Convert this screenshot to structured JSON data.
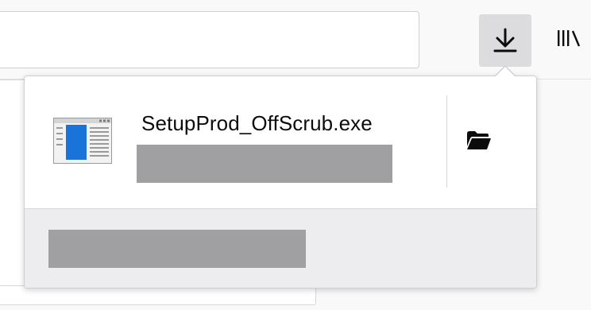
{
  "toolbar": {
    "url_value": "",
    "download_icon": "download-arrow-icon",
    "library_icon": "library-icon",
    "download_button_bg": "#dcdcdf"
  },
  "downloads_panel": {
    "items": [
      {
        "file_name": "SetupProd_OffScrub.exe",
        "file_icon": "executable-file-icon",
        "status_redacted": true,
        "folder_icon": "folder-open-icon"
      }
    ],
    "footer": {
      "show_all_redacted": true
    },
    "colors": {
      "redaction": "#a0a0a2",
      "footer_bg": "#ededf0",
      "file_icon_blue": "#1a73d9"
    }
  }
}
